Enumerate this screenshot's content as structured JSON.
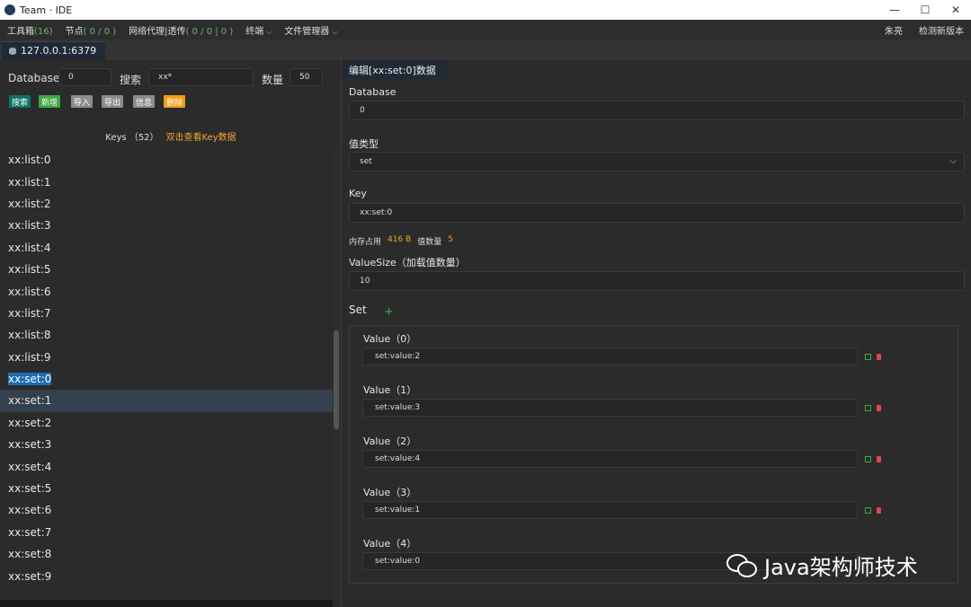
{
  "window": {
    "title": "Team · IDE",
    "controls": {
      "minimize": "—",
      "maximize": "☐",
      "close": "✕"
    }
  },
  "menubar": {
    "items": [
      {
        "label": "工具箱",
        "count": "(16)"
      },
      {
        "label": "节点",
        "count": "( 0 / 0 )"
      },
      {
        "label": "网络代理|透传",
        "count": "( 0 / 0 | 0 )"
      },
      {
        "label": "终端",
        "count": ""
      },
      {
        "label": "文件管理器",
        "count": ""
      }
    ],
    "user": "朱亮",
    "check_update": "检测新版本"
  },
  "connection_tab": {
    "label": "127.0.0.1:6379"
  },
  "left": {
    "database_label": "Database",
    "database_value": "0",
    "search_label": "搜索",
    "search_value": "xx*",
    "count_label": "数量",
    "count_value": "50",
    "buttons": {
      "search": "搜索",
      "add": "新增",
      "import": "导入",
      "export": "导出",
      "info": "信息",
      "delete": "删除"
    },
    "keys_title": "Keys （52）",
    "keys_hint": "双击查看Key数据",
    "keys": [
      "xx:list:0",
      "xx:list:1",
      "xx:list:2",
      "xx:list:3",
      "xx:list:4",
      "xx:list:5",
      "xx:list:6",
      "xx:list:7",
      "xx:list:8",
      "xx:list:9",
      "xx:set:0",
      "xx:set:1",
      "xx:set:2",
      "xx:set:3",
      "xx:set:4",
      "xx:set:5",
      "xx:set:6",
      "xx:set:7",
      "xx:set:8",
      "xx:set:9"
    ],
    "selected_key": "xx:set:0",
    "hover_key": "xx:set:1"
  },
  "editor": {
    "tab_label": "编辑[xx:set:0]数据",
    "database_label": "Database",
    "database_value": "0",
    "type_label": "值类型",
    "type_value": "set",
    "key_label": "Key",
    "key_value": "xx:set:0",
    "memory_label": "内存占用",
    "memory_value": "416 B",
    "value_count_label": "值数量",
    "value_count_value": "5",
    "value_size_label": "ValueSize（加载值数量）",
    "value_size_value": "10",
    "set_label": "Set",
    "add_symbol": "+",
    "values": [
      {
        "label": "Value（0）",
        "value": "set:value:2"
      },
      {
        "label": "Value（1）",
        "value": "set:value:3"
      },
      {
        "label": "Value（2）",
        "value": "set:value:4"
      },
      {
        "label": "Value（3）",
        "value": "set:value:1"
      },
      {
        "label": "Value（4）",
        "value": "set:value:0"
      }
    ]
  },
  "watermark": {
    "text": "Java架构师技术"
  }
}
